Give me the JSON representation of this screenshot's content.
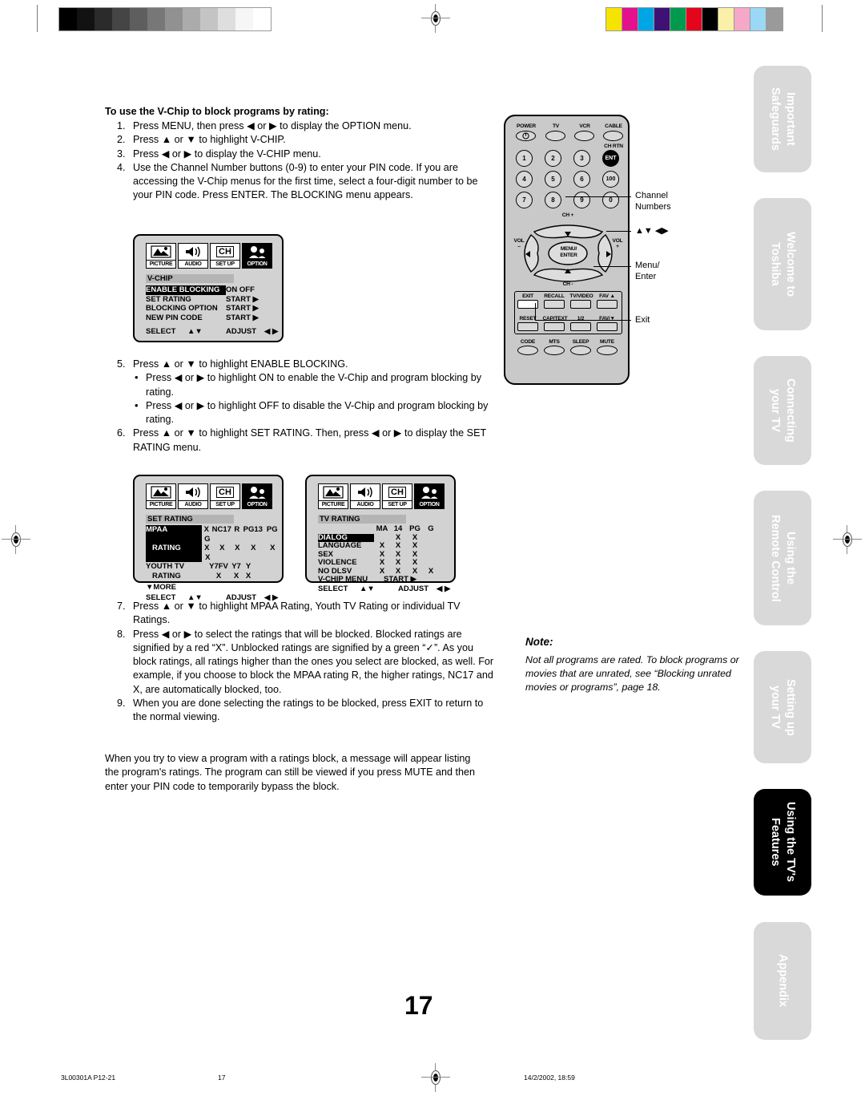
{
  "page": {
    "number": "17",
    "footer": {
      "left": "3L00301A P12-21",
      "center": "17",
      "right": "14/2/2002, 18:59"
    }
  },
  "calibration": {
    "grey_steps": [
      "#000000",
      "#121212",
      "#2b2b2b",
      "#454545",
      "#5e5e5e",
      "#777777",
      "#919191",
      "#ababab",
      "#c4c4c4",
      "#dedede",
      "#f6f6f6",
      "#ffffff"
    ],
    "colors": [
      "#f5e400",
      "#e3128c",
      "#00a5e3",
      "#3d1274",
      "#00994d",
      "#e3051b",
      "#000000",
      "#fbf0a8",
      "#f5a8c8",
      "#9ad8f5",
      "#9a9a9a"
    ]
  },
  "heading": "To use the V-Chip to block programs by rating:",
  "steps": [
    {
      "n": "1.",
      "text": "Press MENU, then press ◀ or ▶ to display the OPTION menu."
    },
    {
      "n": "2.",
      "text": "Press ▲ or ▼ to highlight V-CHIP."
    },
    {
      "n": "3.",
      "text": "Press ◀ or ▶ to display the V-CHIP menu."
    },
    {
      "n": "4.",
      "text": "Use the Channel Number buttons (0-9) to enter your PIN code. If you are accessing the V-Chip menus for the first time, select a four-digit number to be your PIN code. Press ENTER. The BLOCKING menu appears."
    }
  ],
  "steps2": [
    {
      "n": "5.",
      "text": "Press ▲ or ▼ to highlight ENABLE BLOCKING."
    },
    {
      "n": "6.",
      "text": "Press ▲ or ▼ to highlight SET RATING. Then, press ◀ or ▶ to display the SET RATING menu."
    }
  ],
  "bullets": [
    "Press ◀ or ▶ to highlight ON to enable the V-Chip and program blocking by rating.",
    "Press ◀ or ▶ to highlight OFF to disable the V-Chip and program blocking by rating."
  ],
  "steps3": [
    {
      "n": "7.",
      "text": "Press ▲ or ▼ to highlight MPAA Rating, Youth TV Rating or individual TV Ratings."
    },
    {
      "n": "8.",
      "text": "Press ◀ or ▶ to select the ratings that will be blocked. Blocked ratings are signified by a red “X”. Unblocked ratings are signified by a green “✓”. As you block ratings, all ratings higher than the ones you select are blocked, as well. For example, if you choose to block the MPAA rating R, the higher ratings, NC17 and X, are automatically blocked, too."
    },
    {
      "n": "9.",
      "text": "When you are done selecting the ratings to be blocked, press EXIT to return to the normal viewing."
    }
  ],
  "closing": "When you try to view a program with a ratings block, a message will appear listing the program's ratings. The program can still be viewed if you press MUTE and then enter your PIN code to temporarily bypass the block.",
  "note": {
    "title": "Note:",
    "body": "Not all programs are rated. To block programs or movies that are unrated, see “Blocking unrated movies or programs”, page 18."
  },
  "osd_icons": [
    {
      "name": "PICTURE",
      "glyph": "picture"
    },
    {
      "name": "AUDIO",
      "glyph": "audio"
    },
    {
      "name": "SET UP",
      "glyph": "CH"
    },
    {
      "name": "OPTION",
      "glyph": "option"
    }
  ],
  "menu_blocking": {
    "title": "V-CHIP",
    "rows": [
      {
        "label": "ENABLE BLOCKING",
        "value": "ON OFF",
        "highlight": true
      },
      {
        "label": "SET RATING",
        "value": "START ▶",
        "highlight": false
      },
      {
        "label": "BLOCKING OPTION",
        "value": "START ▶",
        "highlight": false
      },
      {
        "label": "NEW PIN CODE",
        "value": "START ▶",
        "highlight": false
      }
    ],
    "footer": {
      "select": "SELECT",
      "select_keys": "▲▼",
      "adjust": "ADJUST",
      "adjust_keys": "◀ ▶"
    }
  },
  "menu_setrating": {
    "title": "SET RATING",
    "mpaa_label": "MPAA",
    "mpaa_rating_label": "RATING",
    "mpaa_columns": [
      "X",
      "NC17",
      "R",
      "PG13",
      "PG",
      "G"
    ],
    "mpaa_marks": [
      "X",
      "X",
      "X",
      "X",
      "X",
      "X"
    ],
    "youth_label": "YOUTH TV",
    "youth_rating_label": "RATING",
    "youth_columns": [
      "Y7FV",
      "Y7",
      "Y"
    ],
    "youth_marks": [
      "X",
      "X",
      "X"
    ],
    "more": "▼MORE",
    "footer": {
      "select": "SELECT",
      "select_keys": "▲▼",
      "adjust": "ADJUST",
      "adjust_keys": "◀ ▶"
    }
  },
  "menu_tvrating": {
    "title": "TV RATING",
    "columns": [
      "MA",
      "14",
      "PG",
      "G"
    ],
    "rows": [
      {
        "label": "DIALOG",
        "marks": [
          "",
          "X",
          "X",
          ""
        ],
        "highlight": true
      },
      {
        "label": "LANGUAGE",
        "marks": [
          "X",
          "X",
          "X",
          ""
        ],
        "highlight": false
      },
      {
        "label": "SEX",
        "marks": [
          "X",
          "X",
          "X",
          ""
        ],
        "highlight": false
      },
      {
        "label": "VIOLENCE",
        "marks": [
          "X",
          "X",
          "X",
          ""
        ],
        "highlight": false
      },
      {
        "label": "NO DLSV",
        "marks": [
          "X",
          "X",
          "X",
          "X"
        ],
        "highlight": false
      }
    ],
    "vchip_menu_label": "V-CHIP MENU",
    "vchip_menu_value": "START ▶",
    "footer": {
      "select": "SELECT",
      "select_keys": "▲▼",
      "adjust": "ADJUST",
      "adjust_keys": "◀ ▶"
    }
  },
  "remote": {
    "row_top": [
      "POWER",
      "TV",
      "VCR",
      "CABLE"
    ],
    "ch_rtn_label": "CH RTN",
    "ent_label": "ENT",
    "keypad": [
      "1",
      "2",
      "3",
      "4",
      "5",
      "6",
      "7",
      "8",
      "9",
      "0"
    ],
    "hundred": "100",
    "ch_plus": "CH +",
    "ch_minus": "CH -",
    "vol_minus": "VOL",
    "vol_minus_sign": "–",
    "vol_plus": "VOL",
    "vol_plus_sign": "+",
    "menu_enter": [
      "MENU/",
      "ENTER"
    ],
    "row_a": [
      "EXIT",
      "RECALL",
      "TV/VIDEO",
      "FAV ▲"
    ],
    "row_b": [
      "RESET",
      "CAP/TEXT",
      "1/2",
      "FAV/▼"
    ],
    "row_c": [
      "CODE",
      "MTS",
      "SLEEP",
      "MUTE"
    ],
    "callouts": [
      {
        "line1": "Channel",
        "line2": "Numbers"
      },
      {
        "line1": "▲▼ ◀▶",
        "line2": ""
      },
      {
        "line1": "Menu/",
        "line2": "Enter"
      },
      {
        "line1": "Exit",
        "line2": ""
      }
    ]
  },
  "side_tabs": [
    {
      "line1": "Important",
      "line2": "Safeguards",
      "active": false
    },
    {
      "line1": "Welcome to",
      "line2": "Toshiba",
      "active": false
    },
    {
      "line1": "Connecting",
      "line2": "your TV",
      "active": false
    },
    {
      "line1": "Using the",
      "line2": "Remote Control",
      "active": false
    },
    {
      "line1": "Setting up",
      "line2": "your TV",
      "active": false
    },
    {
      "line1": "Using the TV's",
      "line2": "Features",
      "active": true
    },
    {
      "line1": "Appendix",
      "line2": "",
      "active": false
    }
  ]
}
